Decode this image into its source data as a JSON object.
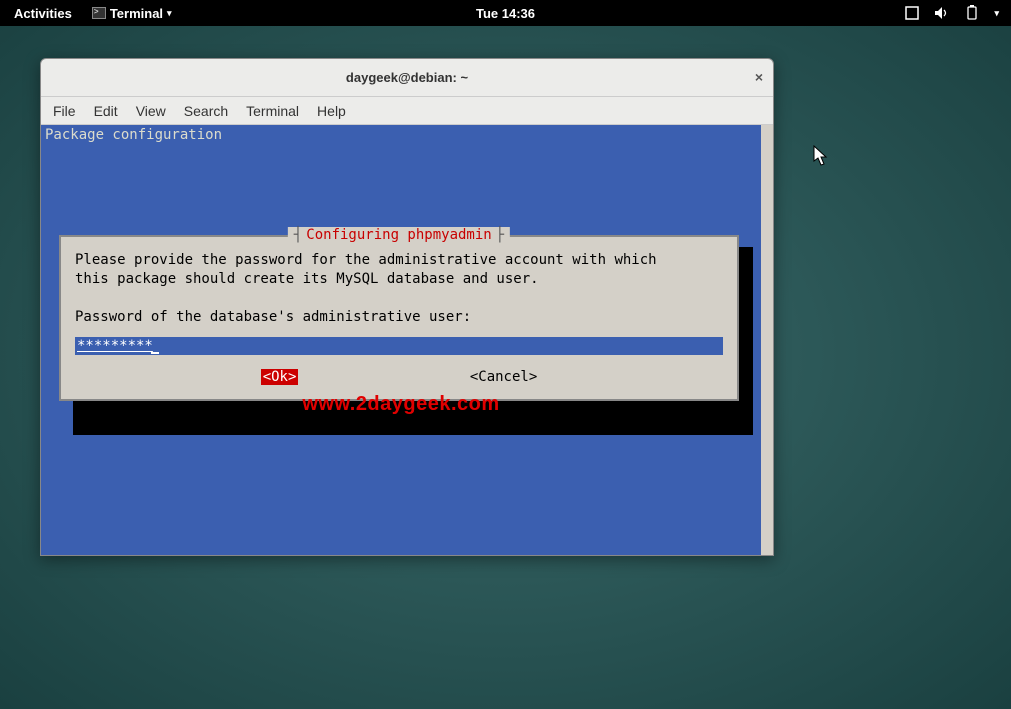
{
  "topbar": {
    "activities": "Activities",
    "app_name": "Terminal",
    "clock": "Tue 14:36"
  },
  "window": {
    "title": "daygeek@debian: ~",
    "menus": [
      "File",
      "Edit",
      "View",
      "Search",
      "Terminal",
      "Help"
    ]
  },
  "terminal": {
    "header_text": "Package configuration"
  },
  "dialog": {
    "title": "Configuring phpmyadmin",
    "body_line1": "Please provide the password for the administrative account with which",
    "body_line2": "this package should create its MySQL database and user.",
    "prompt": "Password of the database's administrative user:",
    "password_masked": "*********",
    "ok_label": "<Ok>",
    "cancel_label": "<Cancel>"
  },
  "watermark": "www.2daygeek.com"
}
